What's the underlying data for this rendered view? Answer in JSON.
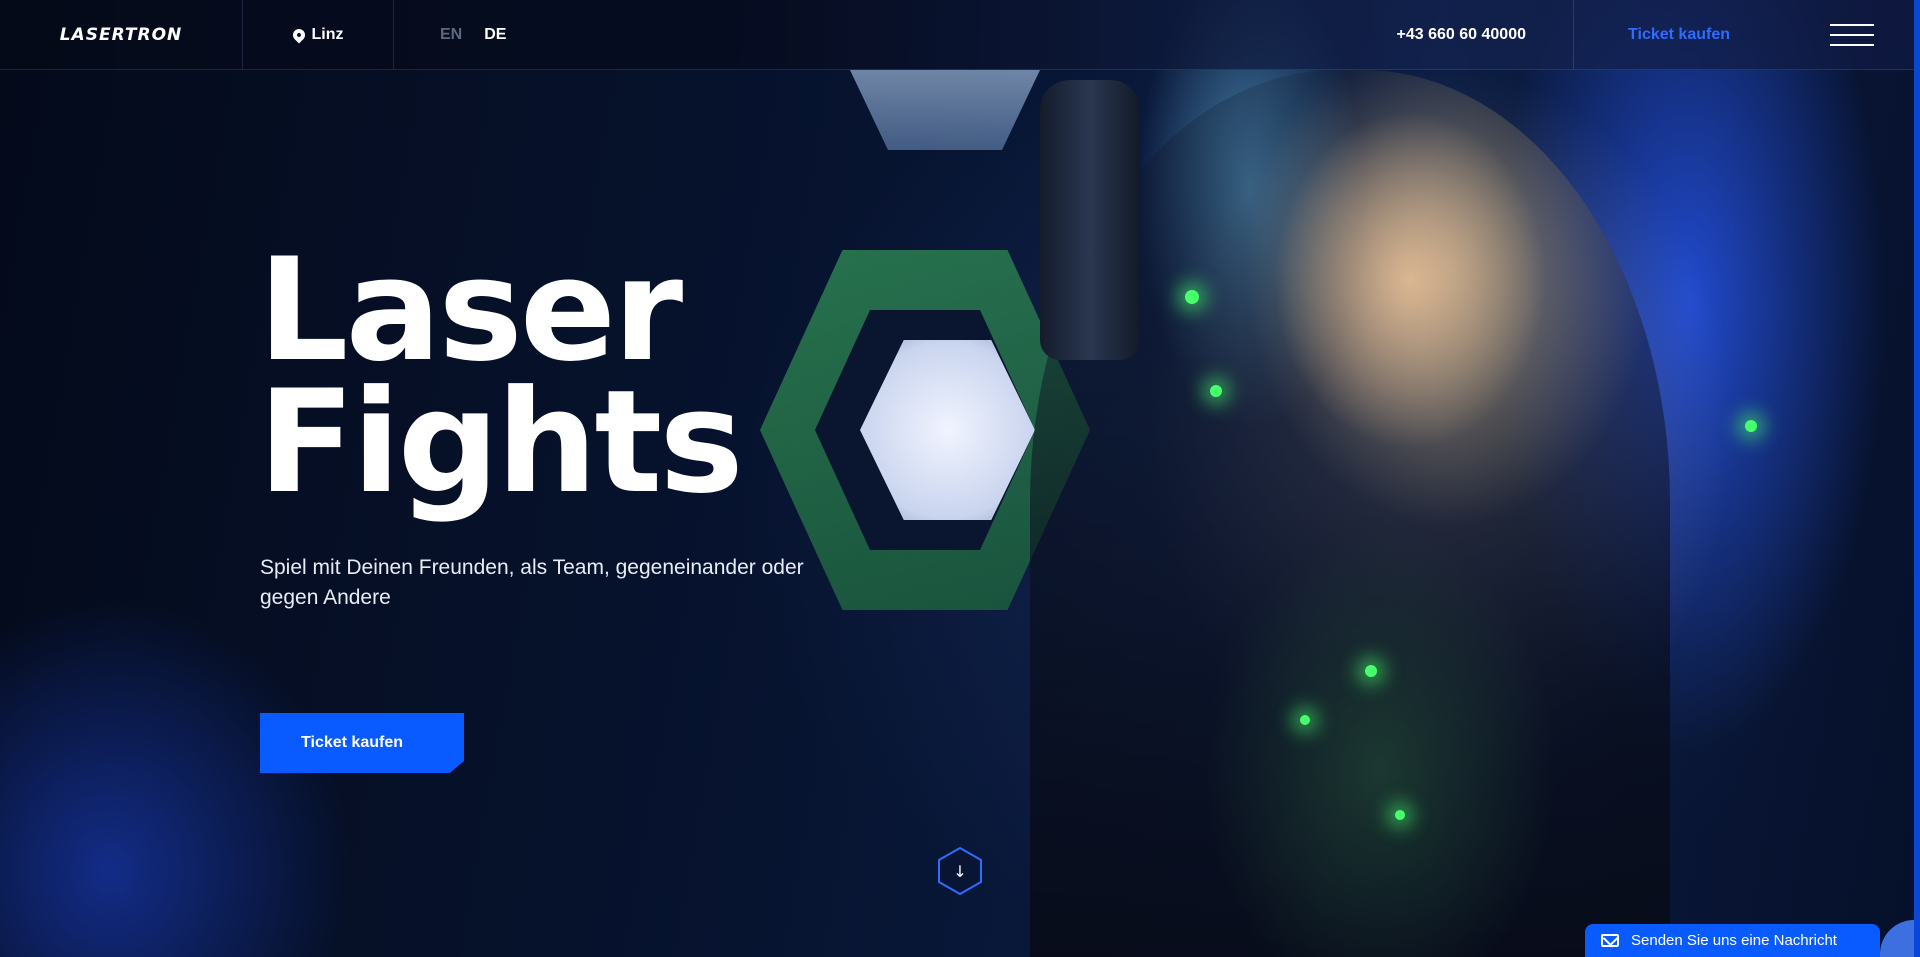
{
  "header": {
    "logo": "LASERTRON",
    "location": "Linz",
    "languages": [
      "EN",
      "DE"
    ],
    "active_language": "DE",
    "phone": "+43 660 60 40000",
    "ticket_label": "Ticket kaufen"
  },
  "hero": {
    "title_line1": "Laser",
    "title_line2": "Fights",
    "subtitle": "Spiel mit Deinen Freunden, als Team, gegeneinander oder gegen Andere",
    "cta_label": "Ticket kaufen"
  },
  "chat_widget": {
    "label": "Senden Sie uns eine Nachricht"
  },
  "colors": {
    "accent": "#0a5bff",
    "header_ticket": "#2f6bff",
    "background": "#050b1c"
  },
  "icons": [
    "location-pin-icon",
    "menu-icon",
    "arrow-down-icon",
    "mail-icon"
  ]
}
